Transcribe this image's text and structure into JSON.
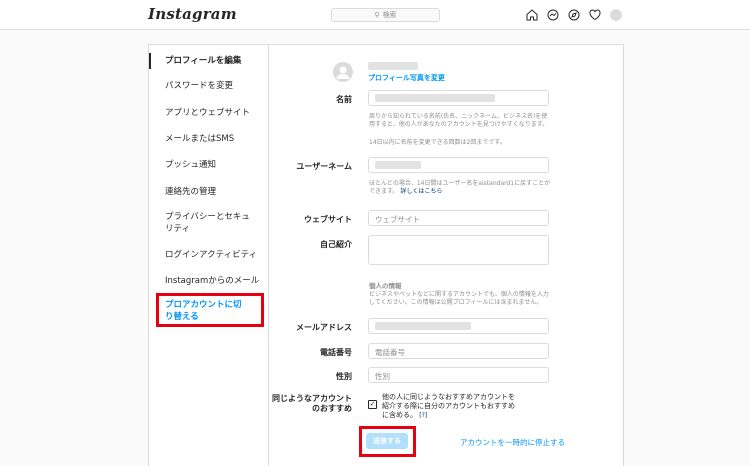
{
  "header": {
    "logo": "Instagram",
    "search_placeholder": "検索",
    "icons": [
      "home-icon",
      "messenger-icon",
      "explore-icon",
      "heart-icon",
      "profile-avatar"
    ]
  },
  "sidebar": {
    "items": [
      {
        "label": "プロフィールを編集"
      },
      {
        "label": "パスワードを変更"
      },
      {
        "label": "アプリとウェブサイト"
      },
      {
        "label": "メールまたはSMS"
      },
      {
        "label": "プッシュ通知"
      },
      {
        "label": "連絡先の管理"
      },
      {
        "label": "プライバシーとセキュリティ"
      },
      {
        "label": "ログインアクティビティ"
      },
      {
        "label": "Instagramからのメール"
      },
      {
        "label": "プロアカウントに切り替える"
      }
    ]
  },
  "profile": {
    "change_photo": "プロフィール写真を変更"
  },
  "form": {
    "name_label": "名前",
    "name_help": "周りから知られている名前(氏名、ニックネーム、ビジネス名)を使用すると、他の人があなたのアカウントを見つけやすくなります。",
    "name_help2": "14日以内に名前を変更できる回数は2回までです。",
    "username_label": "ユーザーネーム",
    "username_help": "ほとんどの場合、14日間はユーザー名をaistandard1に戻すことができます。",
    "username_help_link": "詳しくはこちら",
    "website_label": "ウェブサイト",
    "website_placeholder": "ウェブサイト",
    "bio_label": "自己紹介",
    "personal_title": "個人の情報",
    "personal_help": "ビジネスやペットなどに関するアカウントでも、個人の情報を入力してください。この情報は公開プロフィールには含まれません。",
    "email_label": "メールアドレス",
    "phone_label": "電話番号",
    "phone_placeholder": "電話番号",
    "gender_label": "性別",
    "gender_placeholder": "性別",
    "suggest_label": "同じようなアカウントのおすすめ",
    "suggest_text": "他の人に同じようなおすすめアカウントを紹介する際に自分のアカウントもおすすめに含める。",
    "suggest_help": "[?]",
    "submit": "送信する",
    "deactivate": "アカウントを一時的に停止する"
  },
  "colors": {
    "accent": "#0095f6",
    "highlight": "#e60012"
  }
}
